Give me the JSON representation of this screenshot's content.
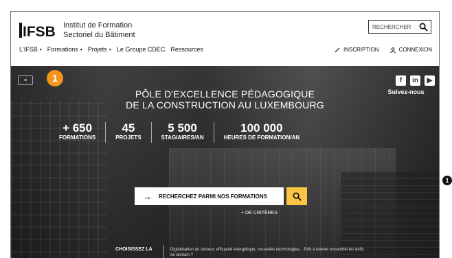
{
  "brand": {
    "logo_text": "IFSB",
    "name_line1": "Institut de Formation",
    "name_line2": "Sectoriel du Bâtiment"
  },
  "search": {
    "placeholder": "RECHERCHER"
  },
  "nav": {
    "items": [
      {
        "label": "L'IFSB",
        "has_caret": true
      },
      {
        "label": "Formations",
        "has_caret": true
      },
      {
        "label": "Projets",
        "has_caret": true
      },
      {
        "label": "Le Groupe CDEC",
        "has_caret": false
      },
      {
        "label": "Ressources",
        "has_caret": false
      }
    ],
    "caret": "▾"
  },
  "account": {
    "signup": "INSCRIPTION",
    "login": "CONNEXION"
  },
  "hero": {
    "menu_toggle": "≡",
    "badge": "1",
    "social": [
      "f",
      "in",
      "▶"
    ],
    "follow": "Suivez-nous",
    "headline_line1": "PÔLE D'EXCELLENCE PÉDAGOGIQUE",
    "headline_line2": "DE LA CONSTRUCTION AU LUXEMBOURG",
    "stats": [
      {
        "value": "+ 650",
        "label": "FORMATIONS"
      },
      {
        "value": "45",
        "label": "PROJETS"
      },
      {
        "value": "5 500",
        "label": "STAGIAIRES/AN"
      },
      {
        "value": "100 000",
        "label": "HEURES DE FORMATION/AN"
      }
    ],
    "cta_arrow": "→",
    "cta_label": "RECHERCHEZ PARMI NOS FORMATIONS",
    "criteria": "+ DE CRITÈRES",
    "choose_label": "CHOISISSEZ LA",
    "choose_desc": "Digitalisation du secteur, efficacité énergétique, nouvelles technologies... Prêt à relever ensemble les défis de demain ?"
  },
  "side_marker": "1",
  "colors": {
    "accent": "#f7941d",
    "cta_yellow": "#f9c543"
  }
}
